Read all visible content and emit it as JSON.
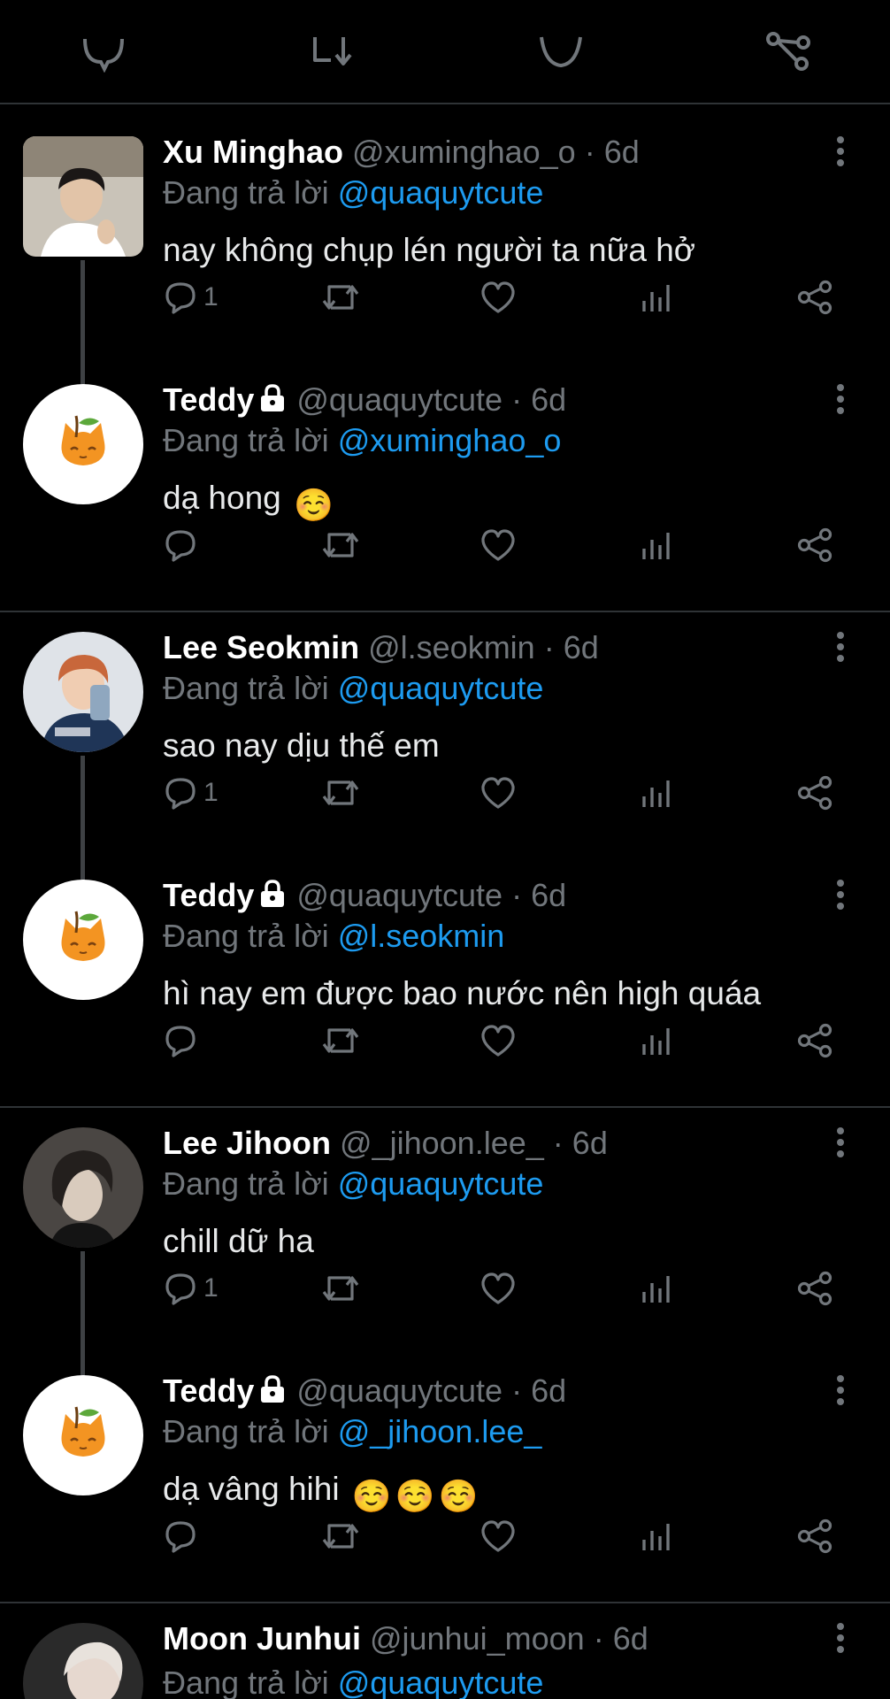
{
  "tweets": [
    {
      "name": "Xu Minghao",
      "handle": "@xuminghao_o",
      "time": "6d",
      "replying_label": "Đang trả lời",
      "mention": "@quaquytcute",
      "text": "nay không chụp lén người ta nữa hở",
      "reply_count": "1",
      "locked": false
    },
    {
      "name": "Teddy",
      "handle": "@quaquytcute",
      "time": "6d",
      "replying_label": "Đang trả lời",
      "mention": "@xuminghao_o",
      "text": "dạ hong",
      "emoji": [
        "☺️"
      ],
      "reply_count": "",
      "locked": true
    },
    {
      "name": "Lee Seokmin",
      "handle": "@l.seokmin",
      "time": "6d",
      "replying_label": "Đang trả lời",
      "mention": "@quaquytcute",
      "text": "sao nay dịu thế em",
      "reply_count": "1",
      "locked": false
    },
    {
      "name": "Teddy",
      "handle": "@quaquytcute",
      "time": "6d",
      "replying_label": "Đang trả lời",
      "mention": "@l.seokmin",
      "text": "hì nay em được bao nước nên high quáa",
      "reply_count": "",
      "locked": true
    },
    {
      "name": "Lee Jihoon",
      "handle": "@_jihoon.lee_",
      "time": "6d",
      "replying_label": "Đang trả lời",
      "mention": "@quaquytcute",
      "text": "chill dữ ha",
      "reply_count": "1",
      "locked": false
    },
    {
      "name": "Teddy",
      "handle": "@quaquytcute",
      "time": "6d",
      "replying_label": "Đang trả lời",
      "mention": "@_jihoon.lee_",
      "text": "dạ vâng hihi",
      "emoji": [
        "☺️",
        "☺️",
        "☺️"
      ],
      "reply_count": "",
      "locked": true
    },
    {
      "name": "Moon Junhui",
      "handle": "@junhui_moon",
      "time": "6d",
      "replying_label": "Đang trả lời",
      "mention": "@quaquytcute",
      "text": "",
      "reply_count": "",
      "locked": false
    }
  ],
  "colors": {
    "background": "#000000",
    "text": "#e7e9ea",
    "secondary": "#71767b",
    "mention": "#1d9bf0",
    "divider": "#2f3336"
  },
  "icons": {
    "reply": "comment-bubble-icon",
    "retweet": "retweet-icon",
    "like": "heart-icon",
    "views": "bar-chart-icon",
    "share": "share-icon",
    "more": "more-vertical-icon",
    "lock": "lock-icon"
  }
}
